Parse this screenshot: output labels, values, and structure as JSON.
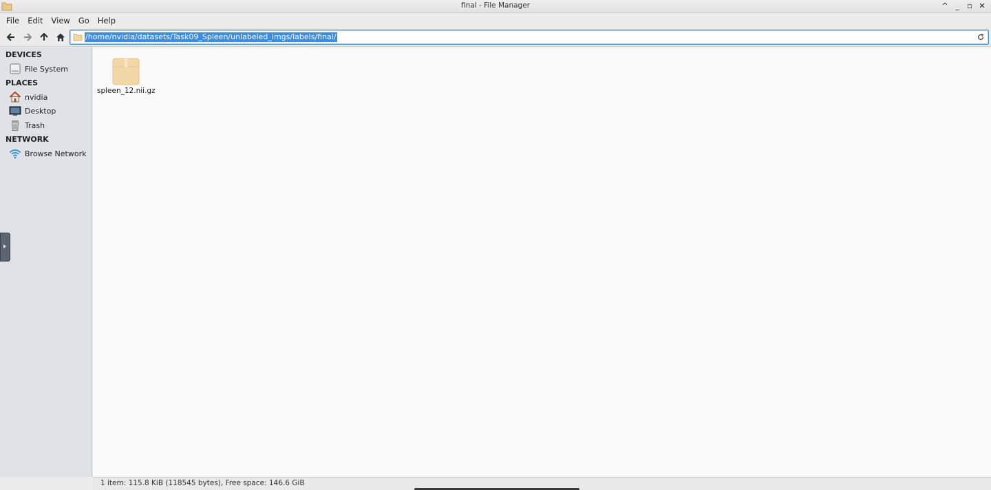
{
  "window": {
    "title": "final - File Manager",
    "controls": [
      "^",
      "_",
      "▫",
      "✕"
    ]
  },
  "menubar": {
    "items": [
      "File",
      "Edit",
      "View",
      "Go",
      "Help"
    ]
  },
  "toolbar": {
    "location_path": "/home/nvidia/datasets/Task09_Spleen/unlabeled_imgs/labels/final/"
  },
  "sidebar": {
    "sections": [
      {
        "title": "DEVICES",
        "items": [
          {
            "label": "File System",
            "icon": "drive-icon"
          }
        ]
      },
      {
        "title": "PLACES",
        "items": [
          {
            "label": "nvidia",
            "icon": "home-icon"
          },
          {
            "label": "Desktop",
            "icon": "desktop-icon"
          },
          {
            "label": "Trash",
            "icon": "trash-icon"
          }
        ]
      },
      {
        "title": "NETWORK",
        "items": [
          {
            "label": "Browse Network",
            "icon": "network-icon"
          }
        ]
      }
    ]
  },
  "files": [
    {
      "name": "spleen_12.nii.gz",
      "icon": "archive-icon"
    }
  ],
  "statusbar": {
    "text": "1 item: 115.8 KiB (118545 bytes), Free space: 146.6 GiB"
  },
  "colors": {
    "selection": "#3d8ee0",
    "sidebar_bg": "#dfe3e8",
    "main_bg": "#fafafa"
  }
}
